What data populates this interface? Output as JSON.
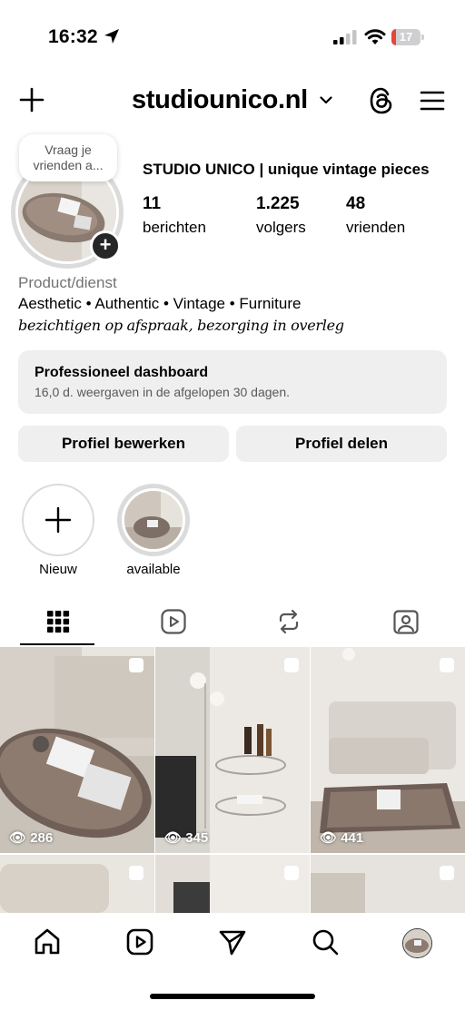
{
  "status_bar": {
    "time": "16:32",
    "battery": "17",
    "battery_level": 0.17,
    "battery_color": "#e5453d"
  },
  "header": {
    "username": "studiounico.nl"
  },
  "profile": {
    "note_bubble": "Vraag je vrienden a...",
    "display_name": "STUDIO UNICO | unique vintage pieces",
    "stats": [
      {
        "value": "11",
        "label": "berichten"
      },
      {
        "value": "1.225",
        "label": "volgers"
      },
      {
        "value": "48",
        "label": "vrienden"
      }
    ],
    "category": "Product/dienst",
    "bio_line1": "Aesthetic • Authentic • Vintage • Furniture",
    "bio_line2": "bezichtigen op afspraak, bezorging in overleg"
  },
  "dashboard": {
    "title": "Professioneel dashboard",
    "subtitle": "16,0 d. weergaven in de afgelopen 30 dagen."
  },
  "buttons": {
    "edit": "Profiel bewerken",
    "share": "Profiel delen"
  },
  "highlights": [
    {
      "label": "Nieuw"
    },
    {
      "label": "available"
    }
  ],
  "tabs": [
    "grid-icon",
    "reels-icon",
    "reposts-icon",
    "tagged-icon"
  ],
  "grid": [
    {
      "views": "286"
    },
    {
      "views": "345"
    },
    {
      "views": "441"
    },
    {
      "views": ""
    },
    {
      "views": ""
    },
    {
      "views": ""
    }
  ],
  "bottom_nav": [
    "home-icon",
    "reels-icon",
    "send-icon",
    "search-icon",
    "profile-avatar"
  ]
}
